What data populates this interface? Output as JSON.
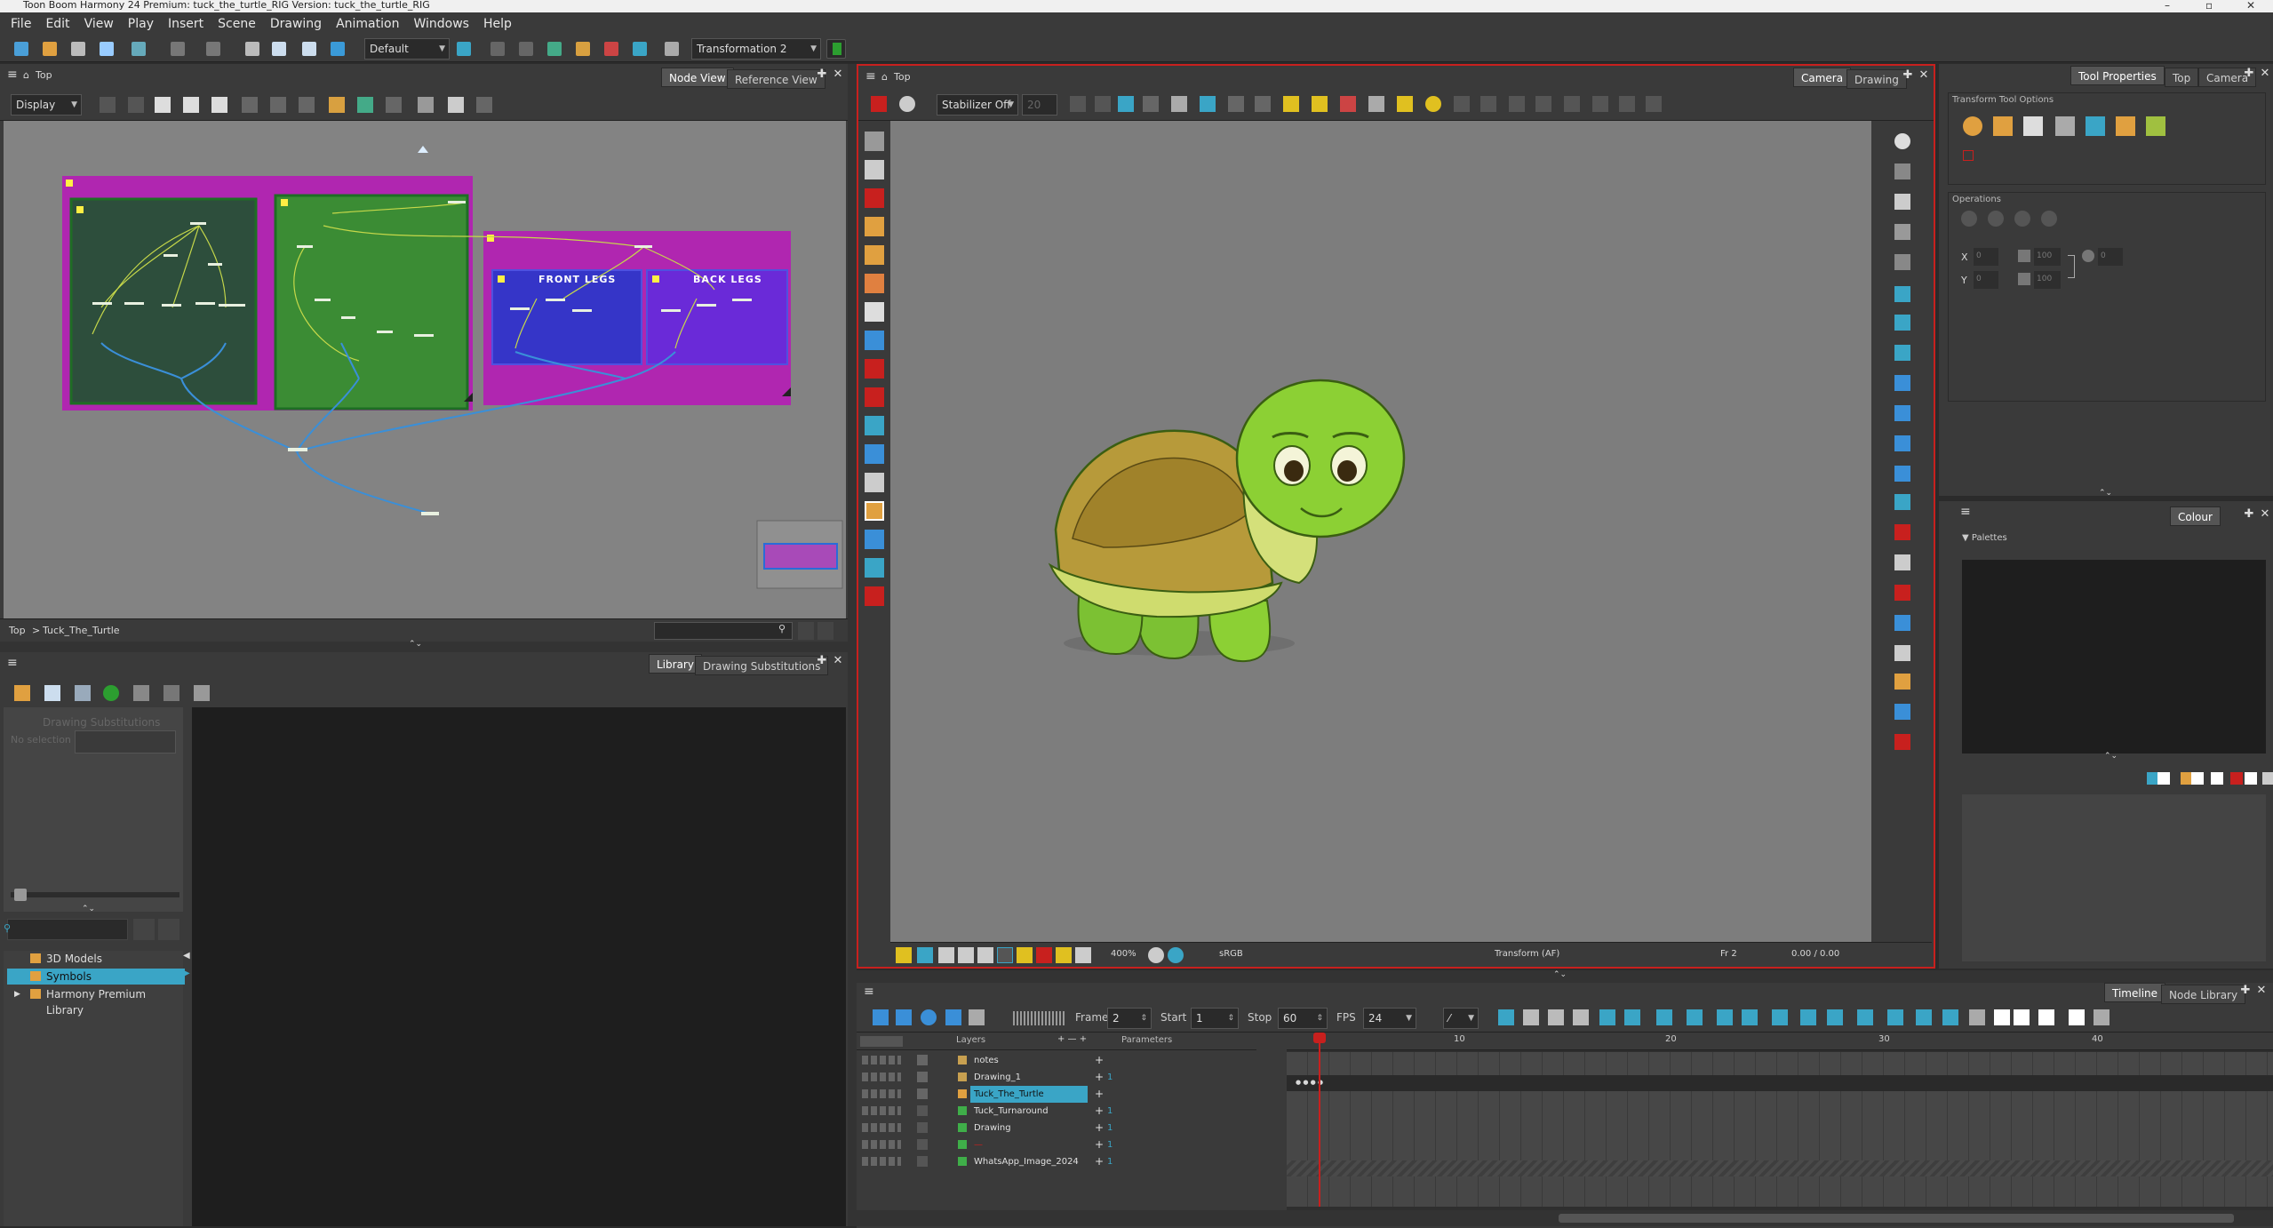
{
  "window": {
    "title": "Toon Boom Harmony 24 Premium: tuck_the_turtle_RIG Version: tuck_the_turtle_RIG"
  },
  "menu": [
    "File",
    "Edit",
    "View",
    "Play",
    "Insert",
    "Scene",
    "Drawing",
    "Animation",
    "Windows",
    "Help"
  ],
  "toolbar": {
    "workspace": "Default",
    "transformation": "Transformation 2"
  },
  "node_view": {
    "breadcrumb_top": "Top",
    "display_combo": "Display",
    "tabs": [
      "Node View",
      "Reference View"
    ],
    "backdrops": {
      "front": "FRONT LEGS",
      "back": "BACK LEGS"
    },
    "path": [
      "Top",
      ">",
      "Tuck_The_Turtle"
    ]
  },
  "library": {
    "tabs": [
      "Library",
      "Drawing Substitutions"
    ],
    "substitutions_label": "Drawing Substitutions",
    "no_selection": "No selection",
    "tree": [
      "3D Models",
      "Symbols",
      "Harmony Premium Library"
    ]
  },
  "camera_view": {
    "breadcrumb_top": "Top",
    "tabs": [
      "Camera",
      "Drawing"
    ],
    "stabilizer": "Stabilizer Off",
    "stabilizer_value": "20",
    "zoom": "400%",
    "status_color": "sRGB",
    "status_tool": "Transform (AF)",
    "status_frame": "Fr 2",
    "status_coords": "0.00 / 0.00"
  },
  "tool_properties": {
    "tabs": [
      "Tool Properties",
      "Top",
      "Camera"
    ],
    "section": "Transform Tool Options",
    "operations": "Operations",
    "fields": {
      "x": "0",
      "y": "0",
      "w": "100",
      "h": "100",
      "angle": "0"
    }
  },
  "colour": {
    "tab": "Colour",
    "palettes_label": "Palettes"
  },
  "timeline": {
    "tabs": [
      "Timeline",
      "Node Library"
    ],
    "frame_label": "Frame",
    "frame": "2",
    "start_label": "Start",
    "start": "1",
    "stop_label": "Stop",
    "stop": "60",
    "fps_label": "FPS",
    "fps": "24",
    "col_layers": "Layers",
    "col_params": "Parameters",
    "ruler": [
      "10",
      "20",
      "30",
      "40"
    ],
    "layers": [
      {
        "name": "notes",
        "color": "#c8a050",
        "selected": false,
        "value": ""
      },
      {
        "name": "Drawing_1",
        "color": "#c8a050",
        "selected": false,
        "value": "1"
      },
      {
        "name": "Tuck_The_Turtle",
        "color": "#e0a040",
        "selected": true,
        "value": ""
      },
      {
        "name": "Tuck_Turnaround",
        "color": "#3fae49",
        "selected": false,
        "value": "1"
      },
      {
        "name": "Drawing",
        "color": "#3fae49",
        "selected": false,
        "value": "1"
      },
      {
        "name": "—",
        "color": "#3fae49",
        "selected": false,
        "value": "1"
      },
      {
        "name": "WhatsApp_Image_2024",
        "color": "#3fae49",
        "selected": false,
        "value": "1"
      }
    ]
  },
  "colors": {
    "accent_red": "#c8201e",
    "select": "#3aa5c6",
    "backdrop_magenta": "#b026b0",
    "backdrop_green": "#2d6e2d",
    "backdrop_blue": "#3535c8"
  }
}
